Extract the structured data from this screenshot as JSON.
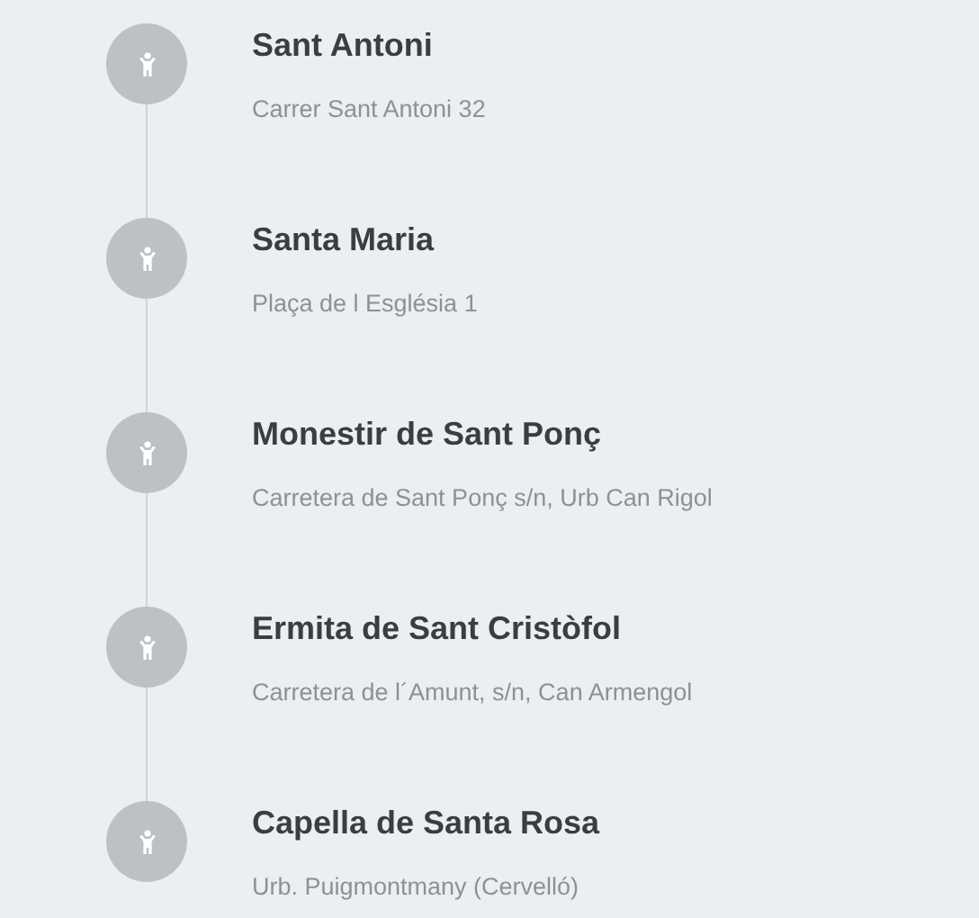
{
  "locations": [
    {
      "name": "Sant Antoni",
      "address": "Carrer Sant Antoni 32"
    },
    {
      "name": "Santa Maria",
      "address": "Plaça de l Església 1"
    },
    {
      "name": "Monestir de Sant Ponç",
      "address": "Carretera de Sant Ponç s/n, Urb Can Rigol"
    },
    {
      "name": "Ermita de Sant Cristòfol",
      "address": "Carretera de l´Amunt, s/n, Can Armengol"
    },
    {
      "name": "Capella de Santa Rosa",
      "address": "Urb. Puigmontmany (Cervelló)"
    }
  ]
}
